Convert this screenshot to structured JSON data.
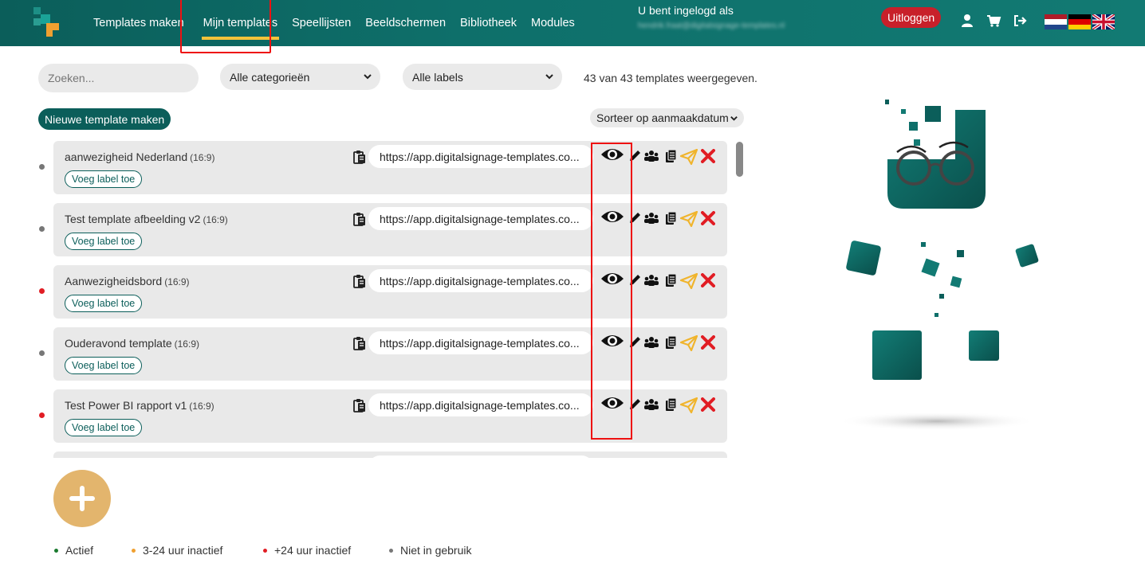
{
  "header": {
    "nav": [
      {
        "label": "Templates maken",
        "active": false
      },
      {
        "label": "Mijn templates",
        "active": true
      },
      {
        "label": "Speellijsten",
        "active": false
      },
      {
        "label": "Beeldschermen",
        "active": false
      },
      {
        "label": "Bibliotheek",
        "active": false
      },
      {
        "label": "Modules",
        "active": false
      }
    ],
    "user_label": "U bent ingelogd als",
    "user_email": "hendrik.fraat@digitalsignage-templates.nl",
    "logout_label": "Uitloggen",
    "icons": [
      "user-icon",
      "cart-icon",
      "sign-out-icon"
    ],
    "flags": [
      "flag-nl",
      "flag-de",
      "flag-gb"
    ]
  },
  "toolbar": {
    "search_placeholder": "Zoeken...",
    "category_select": "Alle categorieën",
    "label_select": "Alle labels",
    "count_text": "43 van 43 templates weergegeven.",
    "new_template_label": "Nieuwe template maken",
    "sort_select": "Sorteer op aanmaakdatum"
  },
  "templates": [
    {
      "name": "aanwezigheid Nederland",
      "ratio": "(16:9)",
      "url": "https://app.digitalsignage-templates.co...",
      "status": "inactive",
      "status_color": "#777777",
      "label_button": "Voeg label toe"
    },
    {
      "name": "Test template afbeelding v2",
      "ratio": "(16:9)",
      "url": "https://app.digitalsignage-templates.co...",
      "status": "inactive",
      "status_color": "#777777",
      "label_button": "Voeg label toe"
    },
    {
      "name": "Aanwezigheidsbord",
      "ratio": "(16:9)",
      "url": "https://app.digitalsignage-templates.co...",
      "status": "24h",
      "status_color": "#e11d24",
      "label_button": "Voeg label toe"
    },
    {
      "name": "Ouderavond template",
      "ratio": "(16:9)",
      "url": "https://app.digitalsignage-templates.co...",
      "status": "inactive",
      "status_color": "#777777",
      "label_button": "Voeg label toe"
    },
    {
      "name": "Test Power BI rapport v1",
      "ratio": "(16:9)",
      "url": "https://app.digitalsignage-templates.co...",
      "status": "24h",
      "status_color": "#e11d24",
      "label_button": "Voeg label toe"
    }
  ],
  "row_actions": [
    "eye-icon",
    "pencil-icon",
    "users-icon",
    "copy-icon",
    "send-icon",
    "delete-icon"
  ],
  "legend": [
    {
      "label": "Actief",
      "color": "#1a7a2e"
    },
    {
      "label": "3-24 uur inactief",
      "color": "#f0a030"
    },
    {
      "label": "+24 uur inactief",
      "color": "#e11d24"
    },
    {
      "label": "Niet in gebruik",
      "color": "#777777"
    }
  ],
  "colors": {
    "brand": "#0b5e5a",
    "accent": "#f3c33a",
    "logout": "#c8202a",
    "add": "#e3b56d",
    "highlight": "#e11111"
  }
}
